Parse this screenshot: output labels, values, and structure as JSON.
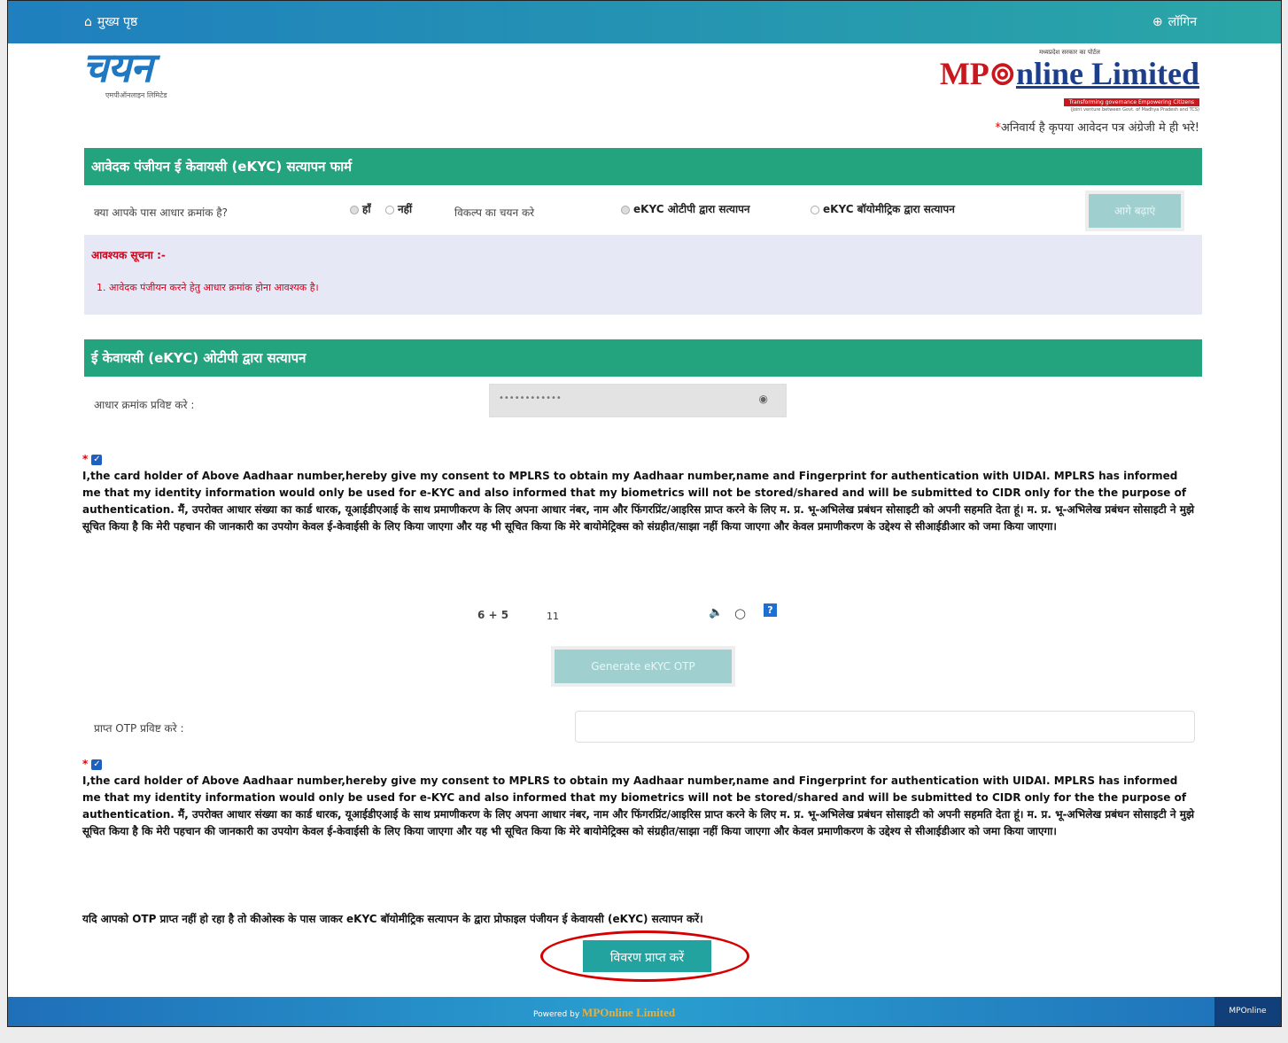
{
  "topbar": {
    "home": "मुख्य पृष्ठ",
    "login": "लॉगिन"
  },
  "logo_left": {
    "text": "चयन",
    "tag": "एमपीऑनलाइन लिमिटेड"
  },
  "logo_right": {
    "small": "मध्यप्रदेश सरकार का पोर्टल",
    "mp": "MP",
    "rest": "nline Limited",
    "band": "Transforming governance Empowering Citizens",
    "sub": "(Joint venture between Govt. of Madhya Pradesh and TCS)"
  },
  "mandatory_note": "अनिवार्य है कृपया आवेदन पत्र अंग्रेजी मे ही भरे!",
  "section1": {
    "title": "आवेदक पंजीयन ई केवायसी (eKYC) सत्यापन फार्म",
    "aadhaar_q": "क्या आपके पास आधार क्रमांक है?",
    "yes": "हाँ",
    "no": "नहीं",
    "choose": "विकल्प का चयन करे",
    "opt_otp": "eKYC ओटीपी द्वारा सत्यापन",
    "opt_bio": "eKYC बॉयोमीट्रिक द्वारा सत्यापन",
    "proceed_btn": "आगे बढ़ाएं"
  },
  "notice": {
    "heading": "आवश्यक सूचना :-",
    "text": "1. आवेदक पंजीयन करने हेतु आधार क्रमांक होना आवश्यक है।"
  },
  "section2": {
    "title": "ई केवायसी (eKYC) ओटीपी द्वारा सत्यापन",
    "aadhaar_label": "आधार क्रमांक प्रविष्ट करे :",
    "aadhaar_value": "••••••••••••",
    "consent": "I,the card holder of Above Aadhaar number,hereby give my consent to MPLRS to obtain my Aadhaar number,name and Fingerprint for authentication with UIDAI. MPLRS has informed me that my identity information would only be used for e-KYC and also informed that my biometrics will not be stored/shared and will be submitted to CIDR only for the the purpose of authentication. मैं, उपरोक्त आधार संख्या का कार्ड धारक, यूआईडीएआई के साथ प्रमाणीकरण के लिए अपना आधार नंबर, नाम और फिंगरप्रिंट/आइरिस प्राप्त करने के लिए म. प्र. भू-अभिलेख प्रबंधन सोसाइटी को अपनी सहमति देता हूं। म. प्र. भू-अभिलेख प्रबंधन सोसाइटी ने मुझे सूचित किया है कि मेरी पहचान की जानकारी का उपयोग केवल ई-केवाईसी के लिए किया जाएगा और यह भी सूचित किया कि मेरे बायोमेट्रिक्स को संग्रहीत/साझा नहीं किया जाएगा और केवल प्रमाणीकरण के उद्देश्य से सीआईडीआर को जमा किया जाएगा।",
    "captcha_q": "6 + 5",
    "captcha_answer": "11",
    "help": "?",
    "generate_btn": "Generate eKYC OTP",
    "otp_label": "प्राप्त OTP प्रविष्ट करे :",
    "no_otp_note": "यदि आपको OTP प्राप्त नहीं हो रहा है तो कीओस्क के पास जाकर eKYC बॉयोमीट्रिक सत्यापन के द्वारा प्रोफाइल पंजीयन ई केवायसी (eKYC) सत्यापन करें।",
    "submit_btn": "विवरण प्राप्त करें"
  },
  "footer": {
    "powered": "Powered by",
    "brand": "MPOnline Limited",
    "right": "MPOnline"
  },
  "colors": {
    "header_bar": "#1f7fbf",
    "section_green": "#23a37e",
    "submit_teal": "#23a3a0",
    "highlight_ring": "#d60000"
  }
}
